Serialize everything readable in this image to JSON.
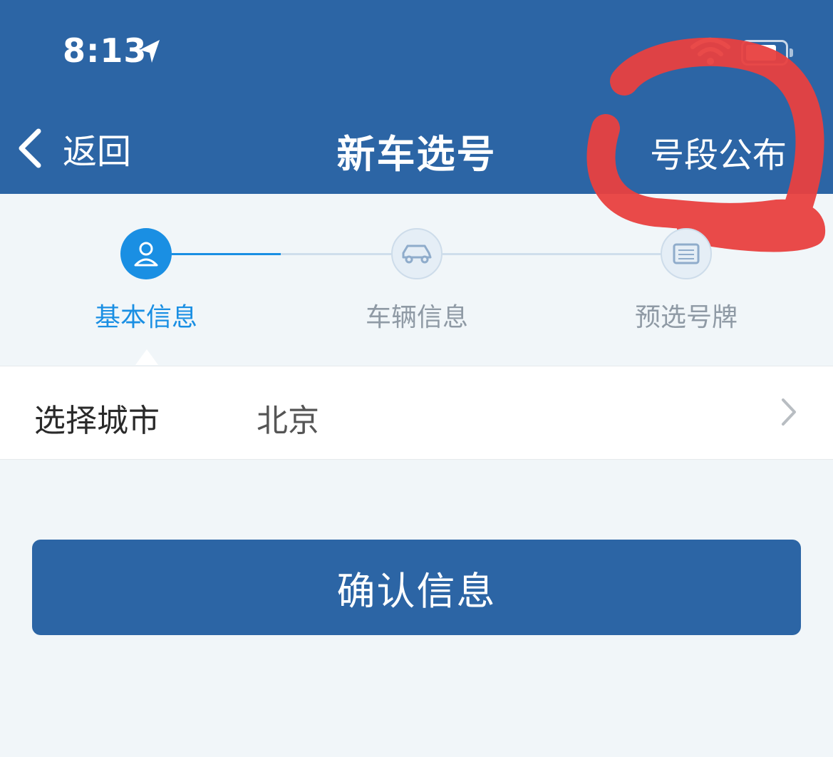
{
  "status_bar": {
    "time": "8:13"
  },
  "nav": {
    "back_label": "返回",
    "title": "新车选号",
    "right_action": "号段公布"
  },
  "steps": [
    {
      "label": "基本信息",
      "icon": "person-icon",
      "state": "active"
    },
    {
      "label": "车辆信息",
      "icon": "car-icon",
      "state": "inactive"
    },
    {
      "label": "预选号牌",
      "icon": "license-plate-icon",
      "state": "inactive"
    }
  ],
  "city_row": {
    "label": "选择城市",
    "value": "北京"
  },
  "confirm_button": {
    "label": "确认信息"
  },
  "colors": {
    "header": "#2c65a5",
    "accent": "#1a8fe3",
    "annotation": "#e8403f",
    "background": "#f1f6f9"
  }
}
